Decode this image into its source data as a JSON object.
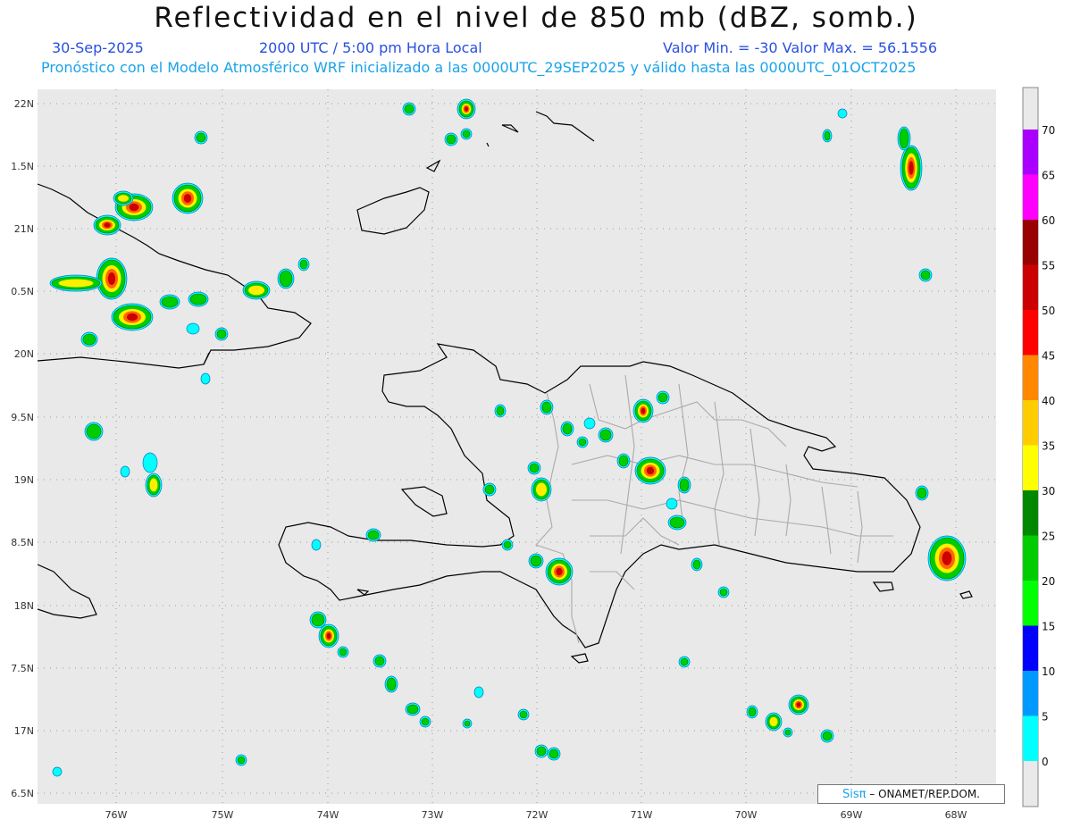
{
  "header": {
    "title": "Reflectividad en el nivel de 850 mb (dBZ, somb.)",
    "date": "30-Sep-2025",
    "time": "2000 UTC / 5:00 pm Hora Local",
    "minmax": "Valor Min. = -30  Valor Max. = 56.1556",
    "subtitle": "Pronóstico con el Modelo Atmosférico WRF inicializado a las 0000UTC_29SEP2025 y válido hasta las  0000UTC_01OCT2025"
  },
  "axes": {
    "lon_labels": [
      "76W",
      "75W",
      "74W",
      "73W",
      "72W",
      "71W",
      "70W",
      "69W",
      "68W"
    ],
    "lat_labels": [
      "22N",
      "1.5N",
      "21N",
      "0.5N",
      "20N",
      "9.5N",
      "19N",
      "8.5N",
      "18N",
      "7.5N",
      "17N",
      "6.5N"
    ]
  },
  "colorbar": {
    "labels": [
      "0",
      "5",
      "10",
      "15",
      "20",
      "25",
      "30",
      "35",
      "40",
      "45",
      "50",
      "55",
      "60",
      "65",
      "70"
    ],
    "colors": [
      "#00ffff",
      "#0099ff",
      "#0000ff",
      "#00ff00",
      "#00cc00",
      "#008800",
      "#ffff00",
      "#ffcc00",
      "#ff8800",
      "#ff0000",
      "#cc0000",
      "#990000",
      "#ff00ff",
      "#aa00ff"
    ]
  },
  "credit": {
    "logo": "Sisπ",
    "text": "– ONAMET/REP.DOM."
  },
  "colors": {
    "map_bg": "#e9e9e9",
    "coast": "#000000",
    "provinces": "#aaaaaa"
  }
}
